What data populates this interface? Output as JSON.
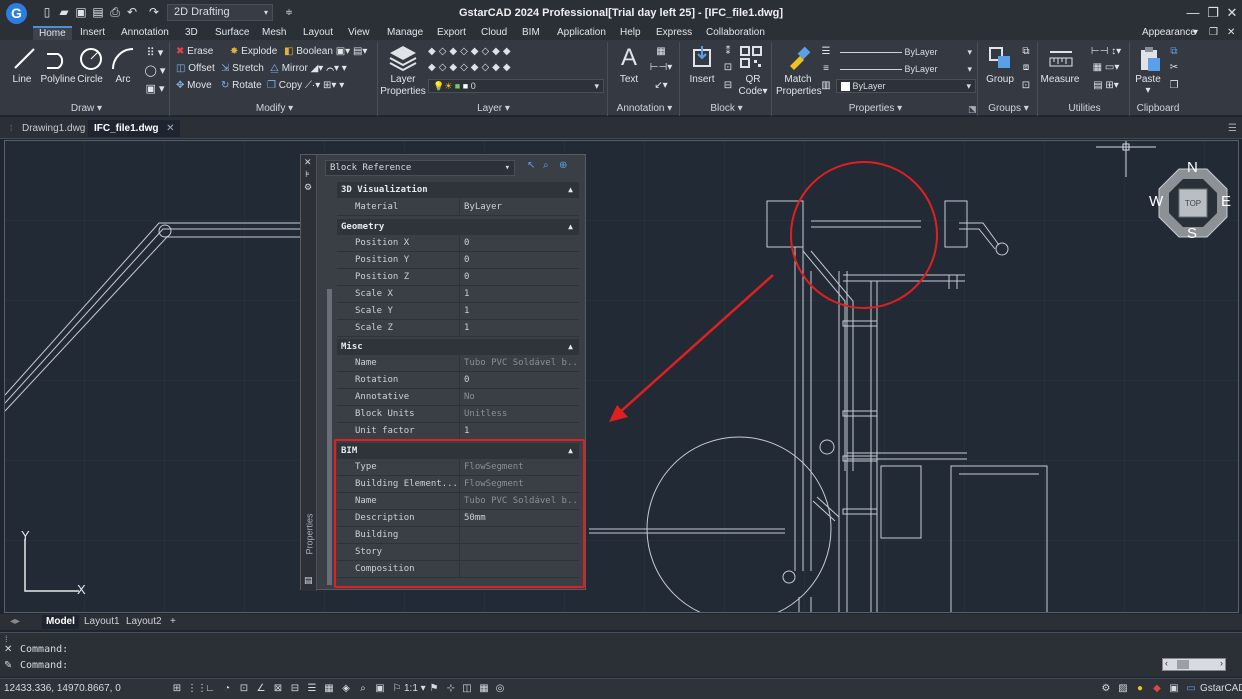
{
  "titlebar": {
    "logo": "G",
    "workspace": "2D Drafting",
    "title": "GstarCAD 2024 Professional[Trial day left 25] - [IFC_file1.dwg]",
    "icons": [
      "new-icon",
      "open-icon",
      "save-icon",
      "saveas-icon",
      "print-icon",
      "undo-icon",
      "redo-icon"
    ],
    "minimize": "—",
    "restore": "❐",
    "close": "✕"
  },
  "menubar": {
    "items": [
      "Home",
      "Insert",
      "Annotation",
      "3D",
      "Surface",
      "Mesh",
      "Layout",
      "View",
      "Manage",
      "Export",
      "Cloud",
      "BIM",
      "Application",
      "Help",
      "Express",
      "Collaboration"
    ],
    "appearance": "Appearance",
    "accent": "#4a90d9"
  },
  "ribbon": {
    "draw": {
      "label": "Draw",
      "tools": [
        "Line",
        "Polyline",
        "Circle",
        "Arc"
      ]
    },
    "modify": {
      "label": "Modify",
      "tools": [
        "Erase",
        "Explode",
        "Boolean",
        "Offset",
        "Stretch",
        "Mirror",
        "Move",
        "Rotate",
        "Copy"
      ]
    },
    "layer": {
      "label": "Layer",
      "button": "Layer\nProperties",
      "button1": "Layer",
      "button2": "Properties"
    },
    "annotation": {
      "label": "Annotation",
      "text": "Text"
    },
    "block": {
      "label": "Block",
      "insert": "Insert",
      "qr1": "QR",
      "qr2": "Code"
    },
    "properties": {
      "label": "Properties",
      "match1": "Match",
      "match2": "Properties",
      "line1": "ByLayer",
      "line2": "ByLayer",
      "color": "ByLayer"
    },
    "groups": {
      "label": "Groups",
      "group": "Group"
    },
    "utilities": {
      "label": "Utilities",
      "measure": "Measure"
    },
    "clipboard": {
      "label": "Clipboard",
      "paste": "Paste"
    }
  },
  "doctabs": [
    "Drawing1.dwg",
    "IFC_file1.dwg"
  ],
  "viewcube": {
    "n": "N",
    "s": "S",
    "e": "E",
    "w": "W",
    "top": "TOP"
  },
  "ucs": {
    "y": "Y",
    "x": "X"
  },
  "properties_palette": {
    "object_type": "Block Reference",
    "side_label": "Properties",
    "sections": [
      {
        "title": "3D Visualization",
        "rows": [
          {
            "k": "Material",
            "v": "ByLayer"
          }
        ]
      },
      {
        "title": "Geometry",
        "rows": [
          {
            "k": "Position X",
            "v": "0"
          },
          {
            "k": "Position Y",
            "v": "0"
          },
          {
            "k": "Position Z",
            "v": "0"
          },
          {
            "k": "Scale X",
            "v": "1"
          },
          {
            "k": "Scale Y",
            "v": "1"
          },
          {
            "k": "Scale Z",
            "v": "1"
          }
        ]
      },
      {
        "title": "Misc",
        "rows": [
          {
            "k": "Name",
            "v": "Tubo PVC Soldável b..."
          },
          {
            "k": "Rotation",
            "v": "0"
          },
          {
            "k": "Annotative",
            "v": "No"
          },
          {
            "k": "Block Units",
            "v": "Unitless"
          },
          {
            "k": "Unit factor",
            "v": "1"
          }
        ]
      },
      {
        "title": "BIM",
        "rows": [
          {
            "k": "Type",
            "v": "FlowSegment"
          },
          {
            "k": "Building Element...",
            "v": "FlowSegment"
          },
          {
            "k": "Name",
            "v": "Tubo PVC Soldável b..."
          },
          {
            "k": "Description",
            "v": "50mm"
          },
          {
            "k": "Building",
            "v": ""
          },
          {
            "k": "Story",
            "v": ""
          },
          {
            "k": "Composition",
            "v": ""
          }
        ]
      }
    ]
  },
  "annotation_color": "#e02020",
  "layout_tabs": [
    "Model",
    "Layout1",
    "Layout2",
    "+"
  ],
  "command": {
    "line1": "Command:",
    "line2": "Command:"
  },
  "status": {
    "coords": "12433.336, 14970.8667, 0",
    "scale": "1:1",
    "app": "GstarCAD"
  }
}
